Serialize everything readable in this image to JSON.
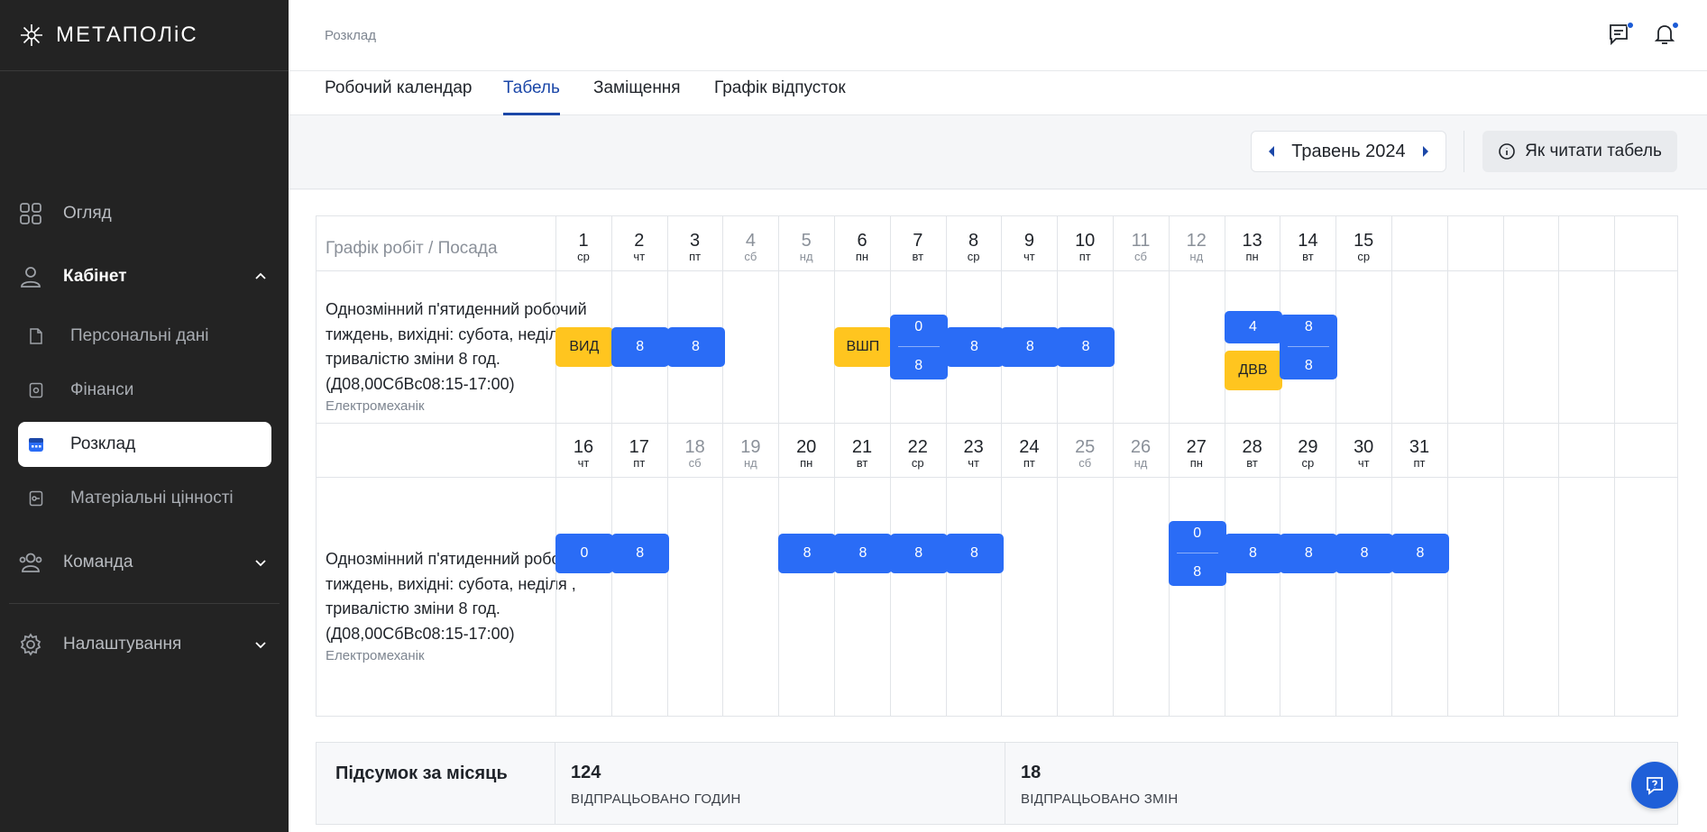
{
  "app": {
    "brand": "МЕТАПОЛіС"
  },
  "sidebar": {
    "items": [
      {
        "label": "Огляд",
        "icon": "grid-icon"
      },
      {
        "label": "Кабінет",
        "icon": "user-icon"
      },
      {
        "label": "Команда",
        "icon": "team-icon"
      },
      {
        "label": "Налаштування",
        "icon": "gear-icon"
      }
    ],
    "cabinet_sub": [
      {
        "label": "Персональні дані",
        "icon": "document-icon"
      },
      {
        "label": "Фінанси",
        "icon": "wallet-icon"
      },
      {
        "label": "Розклад",
        "icon": "calendar-icon",
        "selected": true
      },
      {
        "label": "Матеріальні цінності",
        "icon": "key-icon"
      }
    ]
  },
  "header": {
    "breadcrumb": "Розклад"
  },
  "tabs": [
    {
      "label": "Робочий календар"
    },
    {
      "label": "Табель",
      "active": true
    },
    {
      "label": "Заміщення"
    },
    {
      "label": "Графік відпусток"
    }
  ],
  "toolbar": {
    "month": "Травень 2024",
    "how_to_read": "Як читати табель"
  },
  "table": {
    "column_header": "Графік робіт / Посада",
    "row_label": {
      "title": "Однозмінний п'ятиденний робочий тиждень, вихідні: субота, неділя , тривалістю зміни 8 год. (Д08,00СбВс08:15-17:00)",
      "position": "Електромеханік"
    },
    "week1_days": [
      {
        "num": "1",
        "dow": "ср"
      },
      {
        "num": "2",
        "dow": "чт"
      },
      {
        "num": "3",
        "dow": "пт"
      },
      {
        "num": "4",
        "dow": "сб",
        "weekend": true
      },
      {
        "num": "5",
        "dow": "нд",
        "weekend": true
      },
      {
        "num": "6",
        "dow": "пн"
      },
      {
        "num": "7",
        "dow": "вт"
      },
      {
        "num": "8",
        "dow": "ср"
      },
      {
        "num": "9",
        "dow": "чт"
      },
      {
        "num": "10",
        "dow": "пт"
      },
      {
        "num": "11",
        "dow": "сб",
        "weekend": true
      },
      {
        "num": "12",
        "dow": "нд",
        "weekend": true
      },
      {
        "num": "13",
        "dow": "пн"
      },
      {
        "num": "14",
        "dow": "вт"
      },
      {
        "num": "15",
        "dow": "ср"
      }
    ],
    "week2_days": [
      {
        "num": "16",
        "dow": "чт"
      },
      {
        "num": "17",
        "dow": "пт"
      },
      {
        "num": "18",
        "dow": "сб",
        "weekend": true
      },
      {
        "num": "19",
        "dow": "нд",
        "weekend": true
      },
      {
        "num": "20",
        "dow": "пн"
      },
      {
        "num": "21",
        "dow": "вт"
      },
      {
        "num": "22",
        "dow": "ср"
      },
      {
        "num": "23",
        "dow": "чт"
      },
      {
        "num": "24",
        "dow": "пт"
      },
      {
        "num": "25",
        "dow": "сб",
        "weekend": true
      },
      {
        "num": "26",
        "dow": "нд",
        "weekend": true
      },
      {
        "num": "27",
        "dow": "пн"
      },
      {
        "num": "28",
        "dow": "вт"
      },
      {
        "num": "29",
        "dow": "ср"
      },
      {
        "num": "30",
        "dow": "чт"
      },
      {
        "num": "31",
        "dow": "пт"
      }
    ],
    "week1_cells": [
      {
        "top": "ВИД",
        "color": "yellow"
      },
      {
        "top": "8",
        "color": "blue"
      },
      {
        "top": "8",
        "color": "blue"
      },
      null,
      null,
      {
        "top": "ВШП",
        "color": "yellow"
      },
      {
        "top": "0",
        "bottom": "8",
        "color": "blue"
      },
      {
        "top": "8",
        "color": "blue"
      },
      {
        "top": "8",
        "color": "blue"
      },
      {
        "top": "8",
        "color": "blue"
      },
      null,
      null,
      {
        "top": "4",
        "color": "blue",
        "extra": "ДВВ"
      },
      {
        "top": "8",
        "bottom": "8",
        "color": "blue"
      },
      null
    ],
    "week2_cells": [
      {
        "top": "0",
        "color": "blue"
      },
      {
        "top": "8",
        "color": "blue"
      },
      null,
      null,
      {
        "top": "8",
        "color": "blue"
      },
      {
        "top": "8",
        "color": "blue"
      },
      {
        "top": "8",
        "color": "blue"
      },
      {
        "top": "8",
        "color": "blue"
      },
      null,
      null,
      null,
      {
        "top": "0",
        "bottom": "8",
        "color": "blue"
      },
      {
        "top": "8",
        "color": "blue"
      },
      {
        "top": "8",
        "color": "blue"
      },
      {
        "top": "8",
        "color": "blue"
      },
      {
        "top": "8",
        "color": "blue"
      }
    ]
  },
  "summary": {
    "title": "Підсумок за місяць",
    "hours_value": "124",
    "hours_label": "ВІДПРАЦЬОВАНО ГОДИН",
    "shifts_value": "18",
    "shifts_label": "ВІДПРАЦЬОВАНО ЗМІН"
  },
  "colors": {
    "accent": "#2a6cf6",
    "warn": "#ffc51f",
    "sidebar_bg": "#232323"
  }
}
